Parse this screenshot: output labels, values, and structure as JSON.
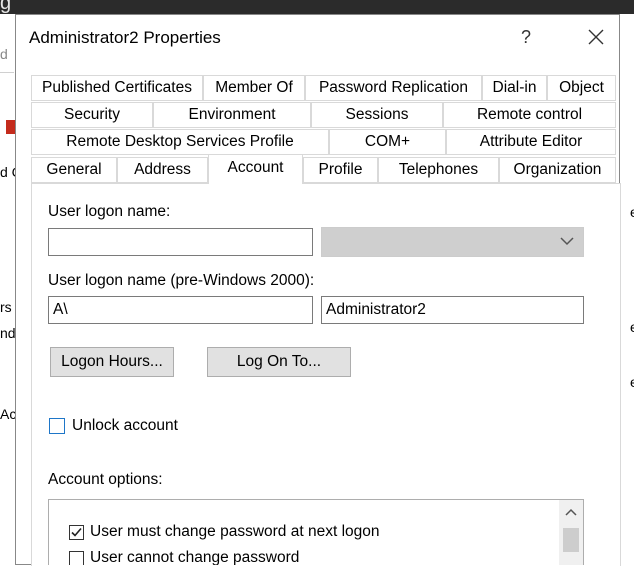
{
  "background": {
    "top_fragment": "g",
    "left_fragments": [
      "d",
      "d C",
      "rs",
      "nd",
      "Ac"
    ],
    "right_fragments": [
      "e",
      "e",
      "e"
    ]
  },
  "window": {
    "title": "Administrator2 Properties",
    "help_label": "?",
    "close_icon": "close-icon"
  },
  "tabs": {
    "row1": [
      "Published Certificates",
      "Member Of",
      "Password Replication",
      "Dial-in",
      "Object"
    ],
    "row2": [
      "Security",
      "Environment",
      "Sessions",
      "Remote control"
    ],
    "row3": [
      "Remote Desktop Services Profile",
      "COM+",
      "Attribute Editor"
    ],
    "row4": [
      "General",
      "Address",
      "Account",
      "Profile",
      "Telephones",
      "Organization"
    ],
    "active": "Account"
  },
  "account": {
    "logon_name_label": "User logon name:",
    "logon_name_value": "",
    "upn_suffix_value": "",
    "pre2000_label": "User logon name (pre-Windows 2000):",
    "pre2000_domain": "A\\",
    "pre2000_user": "Administrator2",
    "logon_hours_button": "Logon Hours...",
    "log_on_to_button": "Log On To...",
    "unlock_label": "Unlock account",
    "unlock_checked": false,
    "account_options_label": "Account options:",
    "options": [
      {
        "label": "User must change password at next logon",
        "checked": true
      },
      {
        "label": "User cannot change password",
        "checked": false
      }
    ]
  },
  "colors": {
    "accent": "#1e76c8",
    "button_face": "#e1e1e1",
    "disabled_combo": "#cfcfcf"
  }
}
